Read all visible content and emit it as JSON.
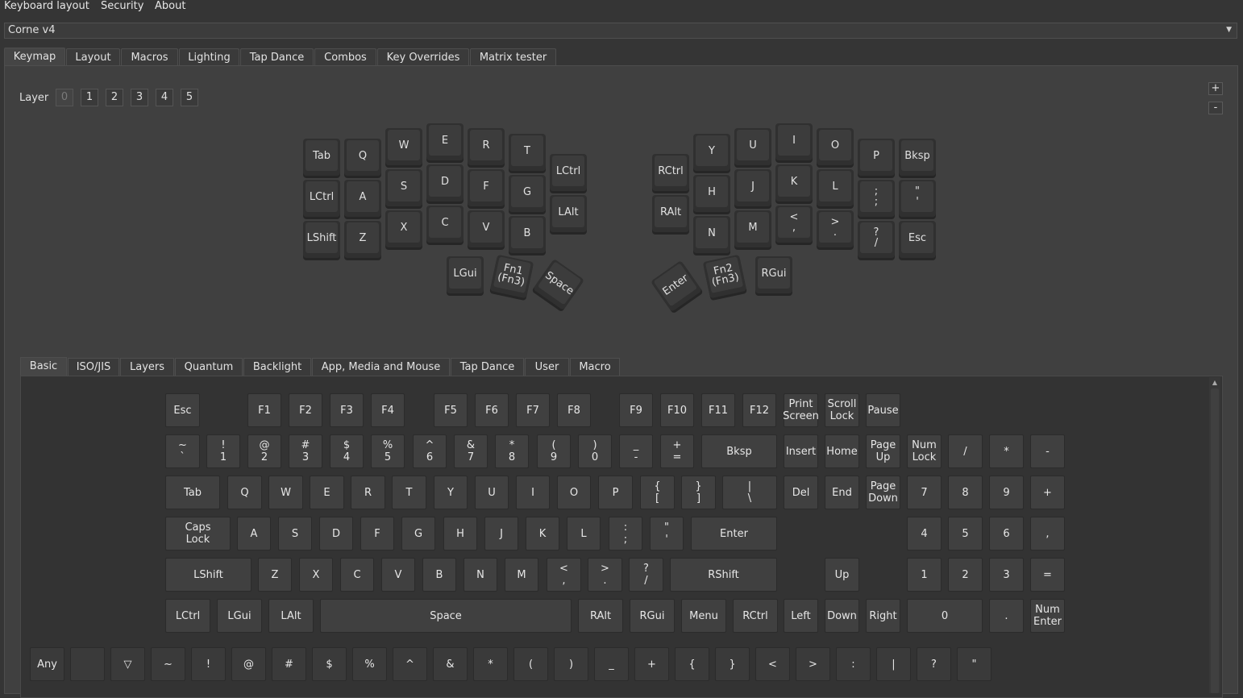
{
  "menubar": {
    "items": [
      "Keyboard layout",
      "Security",
      "About"
    ]
  },
  "device": {
    "selected": "Corne v4",
    "arrow_icon": "chevron-down-icon"
  },
  "tabs": [
    "Keymap",
    "Layout",
    "Macros",
    "Lighting",
    "Tap Dance",
    "Combos",
    "Key Overrides",
    "Matrix tester"
  ],
  "active_tab": "Keymap",
  "layer": {
    "label": "Layer",
    "buttons": [
      "0",
      "1",
      "2",
      "3",
      "4",
      "5"
    ],
    "active": "0",
    "add": "+",
    "remove": "-"
  },
  "split_keys": [
    "Tab",
    "Q",
    "W",
    "E",
    "R",
    "T",
    "LCtrl",
    "LCtrl",
    "A",
    "S",
    "D",
    "F",
    "G",
    "LAlt",
    "LShift",
    "Z",
    "X",
    "C",
    "V",
    "B",
    "LGui",
    "Fn1\n(Fn3)",
    "Space",
    "Y",
    "U",
    "I",
    "O",
    "P",
    "Bksp",
    "RCtrl",
    "H",
    "J",
    "K",
    "L",
    ";\n;",
    "\"\n'",
    "RAlt",
    "N",
    "M",
    "<\n,",
    ">\n.",
    "?\n/",
    "Esc",
    "Enter",
    "Fn2\n(Fn3)",
    "RGui"
  ],
  "bottom_tabs": [
    "Basic",
    "ISO/JIS",
    "Layers",
    "Quantum",
    "Backlight",
    "App, Media and Mouse",
    "Tap Dance",
    "User",
    "Macro"
  ],
  "active_bottom_tab": "Basic",
  "basic_keys": [
    "Esc",
    "F1",
    "F2",
    "F3",
    "F4",
    "F5",
    "F6",
    "F7",
    "F8",
    "F9",
    "F10",
    "F11",
    "F12",
    "Print\nScreen",
    "Scroll\nLock",
    "Pause",
    "~\n`",
    "!\n1",
    "@\n2",
    "#\n3",
    "$\n4",
    "%\n5",
    "^\n6",
    "&\n7",
    "*\n8",
    "(\n9",
    ")\n0",
    "_\n-",
    "+\n=",
    "Bksp",
    "Insert",
    "Home",
    "Page\nUp",
    "Num\nLock",
    "/",
    "*",
    "-",
    "Tab",
    "Q",
    "W",
    "E",
    "R",
    "T",
    "Y",
    "U",
    "I",
    "O",
    "P",
    "{\n[",
    "}\n]",
    "|\n\\",
    "Del",
    "End",
    "Page\nDown",
    "7",
    "8",
    "9",
    "+",
    "Caps\nLock",
    "A",
    "S",
    "D",
    "F",
    "G",
    "H",
    "J",
    "K",
    "L",
    ":\n;",
    "\"\n'",
    "Enter",
    "4",
    "5",
    "6",
    ",",
    "LShift",
    "Z",
    "X",
    "C",
    "V",
    "B",
    "N",
    "M",
    "<\n,",
    ">\n.",
    "?\n/",
    "RShift",
    "Up",
    "1",
    "2",
    "3",
    "=",
    "LCtrl",
    "LGui",
    "LAlt",
    "Space",
    "RAlt",
    "RGui",
    "Menu",
    "RCtrl",
    "Left",
    "Down",
    "Right",
    "0",
    ".",
    "Num\nEnter"
  ],
  "symbol_row": [
    "Any",
    "",
    "▽",
    "~",
    "!",
    "@",
    "#",
    "$",
    "%",
    "^",
    "&",
    "*",
    "(",
    ")",
    "_",
    "+",
    "{",
    "}",
    "<",
    ">",
    ":",
    "|",
    "?",
    "\""
  ]
}
